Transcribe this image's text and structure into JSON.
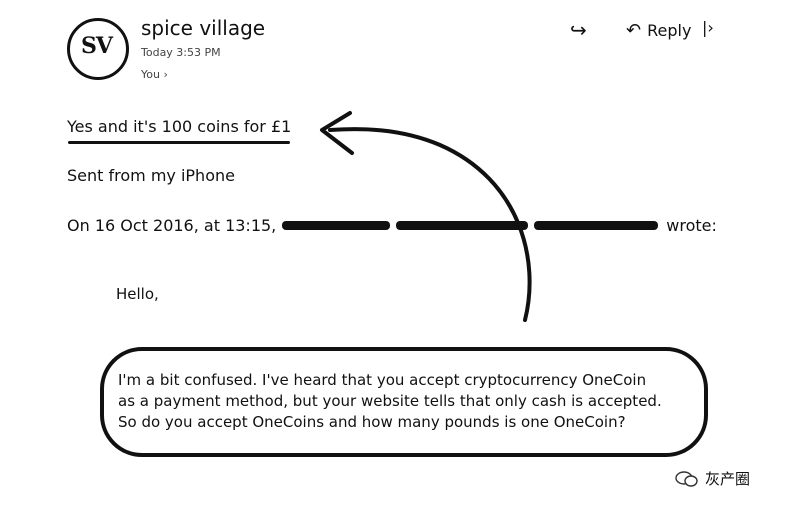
{
  "header": {
    "sender_name": "spice village",
    "avatar_initials": "SV",
    "timestamp": "Today 3:53 PM",
    "recipient": "You",
    "reply_label": "Reply"
  },
  "message": {
    "reply_line": "Yes and it's 100 coins for £1",
    "signature": "Sent from my iPhone",
    "quote_intro_prefix": "On 16 Oct 2016, at 13:15,",
    "quote_intro_suffix": "wrote:",
    "greeting": "Hello,",
    "quoted_lines": [
      "I'm a bit confused. I've heard that you accept cryptocurrency OneCoin",
      "as a payment method, but your website tells that only cash is accepted.",
      "So do you accept OneCoins and how many pounds is one OneCoin?"
    ]
  },
  "watermark": {
    "text": "灰产圈"
  },
  "icons": {
    "forward": "forward-icon",
    "reply": "reply-icon",
    "watermark": "wechat-icon"
  }
}
